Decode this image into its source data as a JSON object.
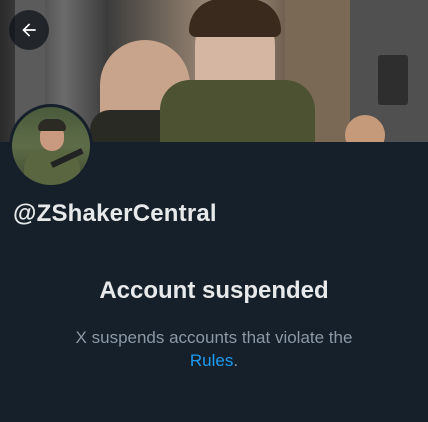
{
  "header": {
    "back_icon": "arrow-left-icon"
  },
  "profile": {
    "handle": "@ZShakerCentral"
  },
  "suspension": {
    "title": "Account suspended",
    "message": "X suspends accounts that violate the",
    "link_text": "Rules",
    "suffix": "."
  },
  "colors": {
    "background": "#15202b",
    "primary_text": "#e7e9ea",
    "secondary_text": "#8b98a5",
    "link": "#1d9bf0"
  }
}
